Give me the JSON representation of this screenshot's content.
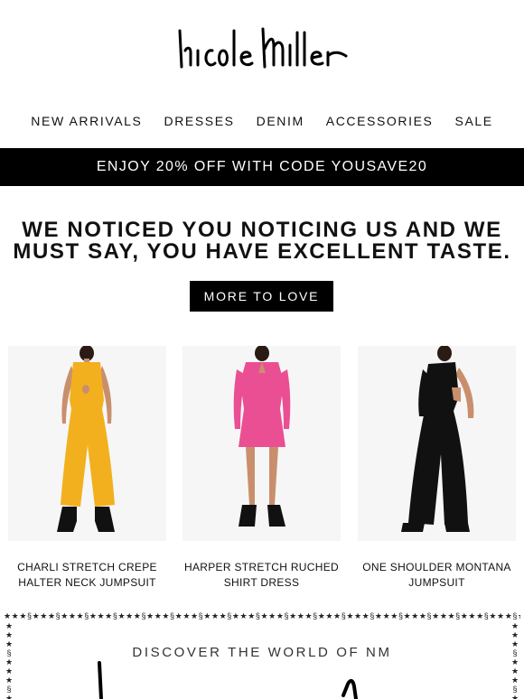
{
  "brand": {
    "logo_text": "nicole miller"
  },
  "nav": {
    "items": [
      {
        "label": "NEW ARRIVALS"
      },
      {
        "label": "DRESSES"
      },
      {
        "label": "DENIM"
      },
      {
        "label": "ACCESSORIES"
      },
      {
        "label": "SALE"
      }
    ]
  },
  "promo": {
    "text": "ENJOY 20% OFF WITH CODE YOUSAVE20"
  },
  "hero": {
    "headline_line1": "WE NOTICED YOU NOTICING US AND WE",
    "headline_line2": "MUST SAY, YOU HAVE EXCELLENT TASTE.",
    "cta_label": "MORE TO LOVE"
  },
  "products": [
    {
      "name_line1": "CHARLI STRETCH CREPE",
      "name_line2": "HALTER NECK JUMPSUIT",
      "color": "#f2b01e"
    },
    {
      "name_line1": "HARPER STRETCH RUCHED",
      "name_line2": "SHIRT DRESS",
      "color": "#ea4f93"
    },
    {
      "name_line1": "ONE SHOULDER MONTANA",
      "name_line2": "JUMPSUIT",
      "color": "#111111"
    }
  ],
  "discover": {
    "title": "DISCOVER THE WORLD OF NM",
    "border_pattern": "★★★§★★★§★★★§★★★§★★★§★★★§★★★§★★★§★★★§★★★§★★★§★★★§★★★§★★★§★★★§★★★§★★★§★★★§★★★§★★★§★★★§★★★§"
  },
  "colors": {
    "accent": "#000000",
    "background": "#ffffff",
    "photo_bg": "#f6f6f6"
  }
}
